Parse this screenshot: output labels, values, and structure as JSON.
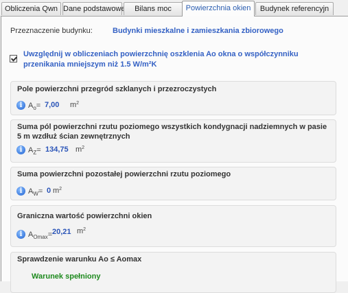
{
  "tabs": [
    {
      "label": "Obliczenia Qwn"
    },
    {
      "label": "Dane podstawowe"
    },
    {
      "label": "Bilans moc"
    },
    {
      "label": "Powierzchnia okien"
    },
    {
      "label": "Budynek referencyjn"
    }
  ],
  "destination": {
    "label": "Przeznaczenie budynku:",
    "value": "Budynki mieszkalne i zamieszkania zbiorowego"
  },
  "include_checkbox": {
    "checked": true,
    "label": "Uwzględnij w obliczeniach powierzchnię oszklenia Ao okna o współczynniku przenikania mniejszym niż 1.5 W/m²K"
  },
  "groups": {
    "ao": {
      "title": "Pole powierzchni przegród szklanych i przezroczystych",
      "symbol": "A",
      "subscript": "o",
      "value": "7,00",
      "unit": "m",
      "unit_sup": "2"
    },
    "az": {
      "title": "Suma pól powierzchni rzutu poziomego wszystkich kondygnacji nadziemnych w pasie 5 m wzdłuż ścian zewnętrznych",
      "symbol": "A",
      "subscript": "Z",
      "value": "134,75",
      "unit": "m",
      "unit_sup": "2"
    },
    "aw": {
      "title": "Suma powierzchni pozostałej powierzchni rzutu poziomego",
      "symbol": "A",
      "subscript": "W",
      "value": "0",
      "unit": "m",
      "unit_sup": "2"
    },
    "aomax": {
      "title": "Graniczna wartość powierzchni okien",
      "symbol": "A",
      "subscript": "Omax",
      "value": "20,21",
      "unit": "m",
      "unit_sup": "2"
    },
    "check": {
      "title": "Sprawdzenie warunku Ao ≤ Aomax",
      "result": "Warunek spełniony"
    }
  },
  "icons": {
    "info": "info-icon",
    "check": "checkmark-icon"
  },
  "colors": {
    "value_blue": "#2b55b8",
    "ok_green": "#1e8a1e",
    "active_tab": "#2a5db0"
  }
}
